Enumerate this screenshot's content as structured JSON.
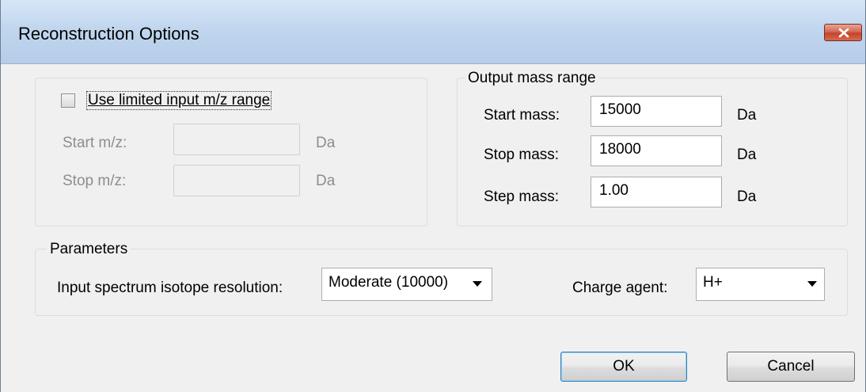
{
  "window": {
    "title": "Reconstruction Options"
  },
  "input_range": {
    "checkbox_label": "Use limited input m/z range",
    "checked": false,
    "start_label": "Start m/z:",
    "start_value": "",
    "start_unit": "Da",
    "stop_label": "Stop m/z:",
    "stop_value": "",
    "stop_unit": "Da"
  },
  "output_range": {
    "title": "Output mass range",
    "start_label": "Start mass:",
    "start_value": "15000",
    "start_unit": "Da",
    "stop_label": "Stop mass:",
    "stop_value": "18000",
    "stop_unit": "Da",
    "step_label": "Step mass:",
    "step_value": "1.00",
    "step_unit": "Da"
  },
  "parameters": {
    "title": "Parameters",
    "resolution_label": "Input spectrum isotope resolution:",
    "resolution_value": "Moderate (10000)",
    "charge_label": "Charge agent:",
    "charge_value": "H+"
  },
  "buttons": {
    "ok": "OK",
    "cancel": "Cancel"
  },
  "colors": {
    "close_button": "#c4432b",
    "titlebar": "#c1d6ee",
    "disabled_text": "#8d8d8d"
  }
}
